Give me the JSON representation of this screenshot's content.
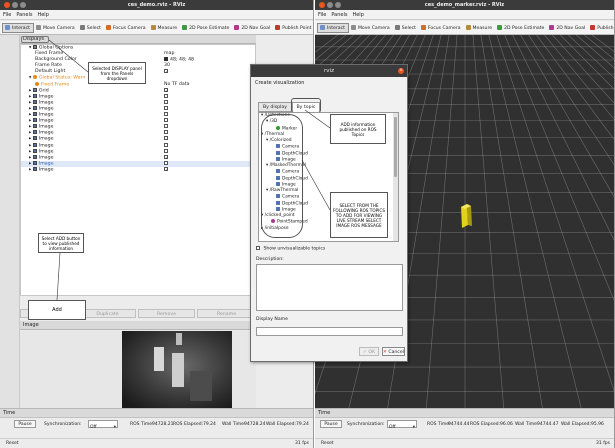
{
  "left_window": {
    "title": "ces_demo.rviz - RViz",
    "menu": [
      "File",
      "Panels",
      "Help"
    ],
    "toolbar": [
      {
        "label": "Interact",
        "icon": "interact-icon",
        "color": "#6f8fc9"
      },
      {
        "label": "Move Camera",
        "icon": "camera-icon",
        "color": "#8c8c8c"
      },
      {
        "label": "Select",
        "icon": "select-icon",
        "color": "#7a7a7a"
      },
      {
        "label": "Focus Camera",
        "icon": "target-icon",
        "color": "#d36b2a"
      },
      {
        "label": "Measure",
        "icon": "ruler-icon",
        "color": "#b38a3e"
      },
      {
        "label": "2D Pose Estimate",
        "icon": "pose-arrow-icon",
        "color": "#3e9a3e"
      },
      {
        "label": "2D Nav Goal",
        "icon": "goal-arrow-icon",
        "color": "#b03b8c"
      },
      {
        "label": "Publish Point",
        "icon": "point-icon",
        "color": "#c0392b"
      }
    ],
    "displays_header": "Displays",
    "display_rows": [
      {
        "label": "Global Options",
        "value": "",
        "indent": 1,
        "expander": "▾",
        "icon": "gear",
        "check": false
      },
      {
        "label": "Fixed Frame",
        "value": "map",
        "indent": 2,
        "expander": "",
        "icon": "",
        "check": false
      },
      {
        "label": "Background Color",
        "value": "48; 48; 48",
        "indent": 2,
        "expander": "",
        "icon": "",
        "check": false
      },
      {
        "label": "Frame Rate",
        "value": "30",
        "indent": 2,
        "expander": "",
        "icon": "",
        "check": false
      },
      {
        "label": "Default Light",
        "value": "",
        "indent": 2,
        "expander": "",
        "icon": "",
        "check": true
      },
      {
        "label": "Global Status: Warn",
        "value": "",
        "indent": 1,
        "expander": "▾",
        "icon": "warn",
        "check": false,
        "warn": true
      },
      {
        "label": "Fixed Frame",
        "value": "No TF data",
        "indent": 2,
        "expander": "",
        "icon": "warn",
        "check": false,
        "warn": true
      },
      {
        "label": "Grid",
        "value": "",
        "indent": 1,
        "expander": "▸",
        "icon": "grid",
        "check": true
      },
      {
        "label": "Image",
        "value": "",
        "indent": 1,
        "expander": "▸",
        "icon": "image",
        "check": false
      },
      {
        "label": "Image",
        "value": "",
        "indent": 1,
        "expander": "▸",
        "icon": "image",
        "check": false
      },
      {
        "label": "Image",
        "value": "",
        "indent": 1,
        "expander": "▸",
        "icon": "image",
        "check": false
      },
      {
        "label": "Image",
        "value": "",
        "indent": 1,
        "expander": "▸",
        "icon": "image",
        "check": false
      },
      {
        "label": "Image",
        "value": "",
        "indent": 1,
        "expander": "▸",
        "icon": "image",
        "check": false
      },
      {
        "label": "Image",
        "value": "",
        "indent": 1,
        "expander": "▸",
        "icon": "image",
        "check": false
      },
      {
        "label": "Image",
        "value": "",
        "indent": 1,
        "expander": "▸",
        "icon": "image",
        "check": false
      },
      {
        "label": "Image",
        "value": "",
        "indent": 1,
        "expander": "▸",
        "icon": "image",
        "check": false
      },
      {
        "label": "Image",
        "value": "",
        "indent": 1,
        "expander": "▸",
        "icon": "image",
        "check": false
      },
      {
        "label": "Image",
        "value": "",
        "indent": 1,
        "expander": "▸",
        "icon": "image",
        "check": false
      },
      {
        "label": "Image",
        "value": "",
        "indent": 1,
        "expander": "▸",
        "icon": "image",
        "check": true
      },
      {
        "label": "Image",
        "value": "",
        "indent": 1,
        "expander": "▸",
        "icon": "image",
        "check": false,
        "selected": true
      },
      {
        "label": "Image",
        "value": "",
        "indent": 1,
        "expander": "▸",
        "icon": "image",
        "check": true
      }
    ],
    "panel_buttons": [
      "Add",
      "Duplicate",
      "Remove",
      "Rename"
    ],
    "image_panel_header": "Image",
    "time_header": "Time",
    "time": {
      "pause": "Pause",
      "sync_label": "Synchronization:",
      "sync_value": "Off",
      "ros_time_label": "ROS Time:",
      "ros_time": "94728.21",
      "ros_elapsed_label": "ROS Elapsed:",
      "ros_elapsed": "79.24",
      "wall_time_label": "Wall Time:",
      "wall_time": "94728.24",
      "wall_elapsed_label": "Wall Elapsed:",
      "wall_elapsed": "79.24"
    },
    "reset": "Reset",
    "fps": "31 fps"
  },
  "callouts": {
    "displays_note": "Selected DISPLAY panel from the Panels dropdown",
    "add_note": "Select ADD button to view published information",
    "add_box": "Add",
    "topic_note": "ADD information published on ROS Topics",
    "select_note": "SELECT FROM THE FOLLOWING ROS TOPICS TO ADD FOR VIEWING LIVE STREAM SELECT IMAGE ROS MESSAGE"
  },
  "dialog": {
    "title": "rviz",
    "heading": "Create visualization",
    "tab_display_type": "By display type",
    "tab_topic": "By topic",
    "topics": [
      {
        "label": "/Detections",
        "indent": 0,
        "exp": "▾",
        "icon": ""
      },
      {
        "label": "/3D",
        "indent": 1,
        "exp": "▾",
        "icon": ""
      },
      {
        "label": "Marker",
        "indent": 3,
        "exp": "",
        "icon": "marker"
      },
      {
        "label": "/Thermal",
        "indent": 0,
        "exp": "▾",
        "icon": ""
      },
      {
        "label": "/Colorized",
        "indent": 1,
        "exp": "▾",
        "icon": ""
      },
      {
        "label": "Camera",
        "indent": 3,
        "exp": "",
        "icon": "camera"
      },
      {
        "label": "DepthCloud",
        "indent": 3,
        "exp": "",
        "icon": "cloud"
      },
      {
        "label": "Image",
        "indent": 3,
        "exp": "",
        "icon": "image"
      },
      {
        "label": "/MaskedThermal",
        "indent": 1,
        "exp": "▾",
        "icon": ""
      },
      {
        "label": "Camera",
        "indent": 3,
        "exp": "",
        "icon": "camera"
      },
      {
        "label": "DepthCloud",
        "indent": 3,
        "exp": "",
        "icon": "cloud"
      },
      {
        "label": "Image",
        "indent": 3,
        "exp": "",
        "icon": "image"
      },
      {
        "label": "/RawThermal",
        "indent": 1,
        "exp": "▾",
        "icon": ""
      },
      {
        "label": "Camera",
        "indent": 3,
        "exp": "",
        "icon": "camera"
      },
      {
        "label": "DepthCloud",
        "indent": 3,
        "exp": "",
        "icon": "cloud"
      },
      {
        "label": "Image",
        "indent": 3,
        "exp": "",
        "icon": "image"
      },
      {
        "label": "/clicked_point",
        "indent": 0,
        "exp": "▾",
        "icon": ""
      },
      {
        "label": "PointStamped",
        "indent": 2,
        "exp": "",
        "icon": "point"
      },
      {
        "label": "/initialpose",
        "indent": 0,
        "exp": "▸",
        "icon": ""
      }
    ],
    "show_unvisualizable": "Show unvisualizable topics",
    "description_label": "Description:",
    "display_name_label": "Display Name",
    "ok": "OK",
    "cancel": "Cancel"
  },
  "right_window": {
    "title": "ces_demo_marker.rviz - RViz",
    "menu": [
      "File",
      "Panels",
      "Help"
    ],
    "toolbar": [
      {
        "label": "Interact",
        "icon": "interact-icon",
        "color": "#6f8fc9"
      },
      {
        "label": "Move Camera",
        "icon": "camera-icon",
        "color": "#8c8c8c"
      },
      {
        "label": "Select",
        "icon": "select-icon",
        "color": "#7a7a7a"
      },
      {
        "label": "Focus Camera",
        "icon": "target-icon",
        "color": "#d36b2a"
      },
      {
        "label": "Measure",
        "icon": "ruler-icon",
        "color": "#b38a3e"
      },
      {
        "label": "2D Pose Estimate",
        "icon": "pose-arrow-icon",
        "color": "#3e9a3e"
      },
      {
        "label": "2D Nav Goal",
        "icon": "goal-arrow-icon",
        "color": "#b03b8c"
      },
      {
        "label": "Publish Point",
        "icon": "point-icon",
        "color": "#c0392b"
      }
    ],
    "time_header": "Time",
    "time": {
      "pause": "Pause",
      "sync_label": "Synchronization:",
      "sync_value": "Off",
      "ros_time_label": "ROS Time:",
      "ros_time": "94744.44",
      "ros_elapsed_label": "ROS Elapsed:",
      "ros_elapsed": "96.06",
      "wall_time_label": "Wall Time:",
      "wall_time": "94744.47",
      "wall_elapsed_label": "Wall Elapsed:",
      "wall_elapsed": "95.96"
    },
    "reset": "Reset",
    "fps": "31 fps"
  },
  "colors": {
    "titlebar": "#3b3b3b",
    "viewport_bg": "#303030",
    "grid_line": "#a0a0a0",
    "marker": "#e3d21c",
    "close_button": "#e95420",
    "warn": "#e08a1e",
    "ok_icon": "#2f9e2f"
  }
}
